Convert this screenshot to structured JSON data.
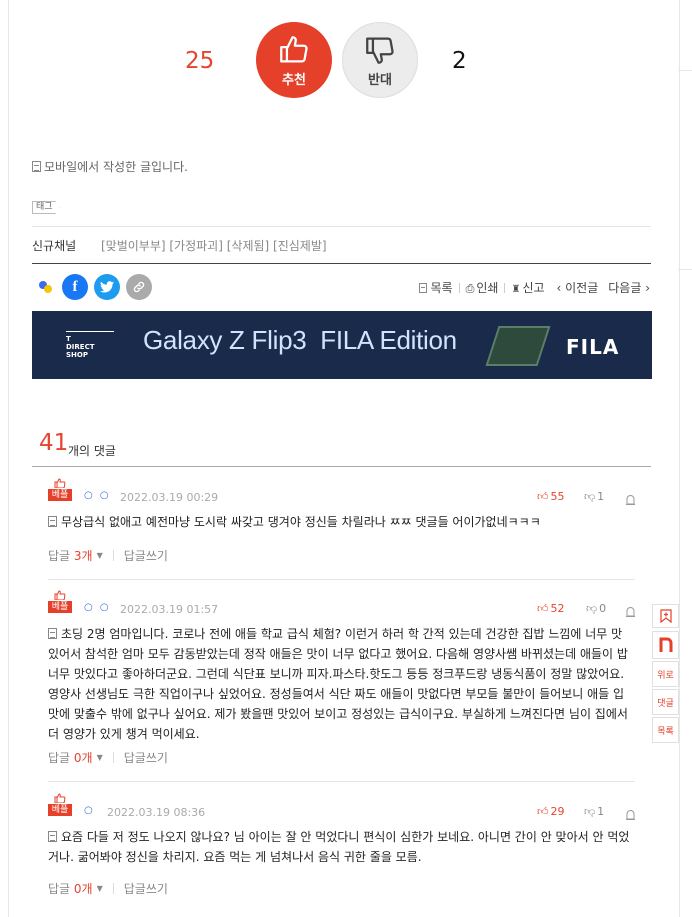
{
  "vote": {
    "up_count": "25",
    "up_label": "추천",
    "down_label": "반대",
    "down_count": "2"
  },
  "post": {
    "mobile_note": "모바일에서 작성한 글입니다.",
    "tag_label": "태그",
    "channel_label": "신규채널",
    "channel_tags": "[맞벌이부부] [가정파괴] [삭제됨] [진심제발]"
  },
  "toolbar": {
    "list": "목록",
    "print": "인쇄",
    "report": "신고",
    "prev": "‹ 이전글",
    "next": "다음글 ›"
  },
  "banner": {
    "shop": "T\nDIRECT\nSHOP",
    "slogan": "Galaxy Z Flip3  FILA Edition",
    "brand": "FILA"
  },
  "comments_header": {
    "count": "41",
    "suffix": "개의 댓글"
  },
  "comments": [
    {
      "badge": "베플",
      "nick": "○ ○",
      "date": "2022.03.19 00:29",
      "up": "55",
      "down": "1",
      "body": "무상급식 없애고 예전마냥 도시락 싸갖고 댕겨야 정신들 차릴라나 ㅉㅉ 댓글들 어이가없네ㅋㅋㅋ",
      "reply_label": "답글",
      "reply_count": "3개",
      "write_label": "답글쓰기"
    },
    {
      "badge": "베플",
      "nick": "○ ○",
      "date": "2022.03.19 01:57",
      "up": "52",
      "down": "0",
      "body": "초딩 2명 엄마입니다. 코로나 전에 애들 학교 급식 체험? 이런거 하러 학 간적 있는데 건강한 집밥 느낌에 너무 맛있어서 참석한 엄마 모두 감동받았는데 정작 애들은 맛이 너무 없다고 했어요. 다음해 영양사쌤 바뀌셨는데 애들이 밥 너무 맛있다고 좋아하더군요. 그런데 식단표 보니까 피자.파스타.핫도그 등등 정크푸드랑 냉동식품이 정말 많았어요. 영양사 선생님도 극한 직업이구나 싶었어요. 정성들여서 식단 짜도 애들이 맛없다면 부모들 불만이 들어보니 애들 입맛에 맞출수 밖에 없구나 싶어요. 제가 봤을땐 맛있어 보이고 정성있는 급식이구요. 부실하게 느껴진다면 님이 집에서 더 영양가 있게 챙겨 먹이세요.",
      "reply_label": "답글",
      "reply_count": "0개",
      "write_label": "답글쓰기"
    },
    {
      "badge": "베플",
      "nick": "○",
      "date": "2022.03.19 08:36",
      "up": "29",
      "down": "1",
      "body": "요즘 다들 저 정도 나오지 않나요? 님 아이는 잘 안 먹었다니 편식이 심한가 보네요. 아니면 간이 안 맞아서 안 먹었거나. 굶어봐야 정신을 차리지. 요즘 먹는 게 넘쳐나서 음식 귀한 줄을 모름.",
      "reply_label": "답글",
      "reply_count": "0개",
      "write_label": "답글쓰기"
    }
  ],
  "side_menu": {
    "top": "위로",
    "comments": "댓글",
    "list": "목록"
  },
  "colors": {
    "accent": "#e5402a",
    "banner_bg": "#1a2a4b",
    "facebook": "#1877f2",
    "twitter": "#1d9bf0"
  }
}
